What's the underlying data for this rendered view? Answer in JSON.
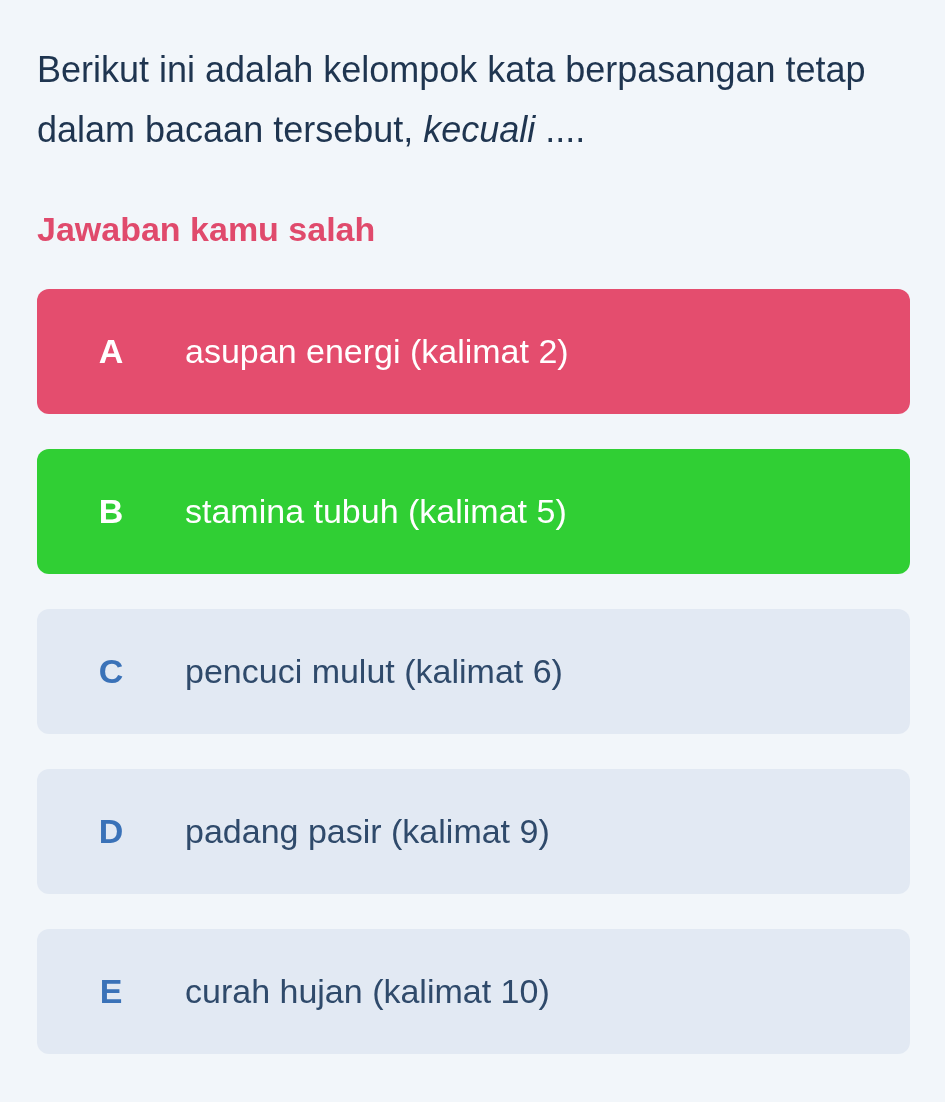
{
  "question": "Berikut ini adalah kelompok kata berpasangan tetap dalam bacaan tersebut, *kecuali* ....",
  "feedback": "Jawaban kamu salah",
  "options": [
    {
      "letter": "A",
      "text": "asupan energi (kalimat 2)",
      "selected": true,
      "correct": false
    },
    {
      "letter": "B",
      "text": "stamina tubuh (kalimat 5)",
      "selected": false,
      "correct": true
    },
    {
      "letter": "C",
      "text": "pencuci mulut (kalimat 6)",
      "selected": false,
      "correct": false
    },
    {
      "letter": "D",
      "text": "padang pasir (kalimat 9)",
      "selected": false,
      "correct": false
    },
    {
      "letter": "E",
      "text": "curah hujan (kalimat 10)",
      "selected": false,
      "correct": false
    }
  ]
}
